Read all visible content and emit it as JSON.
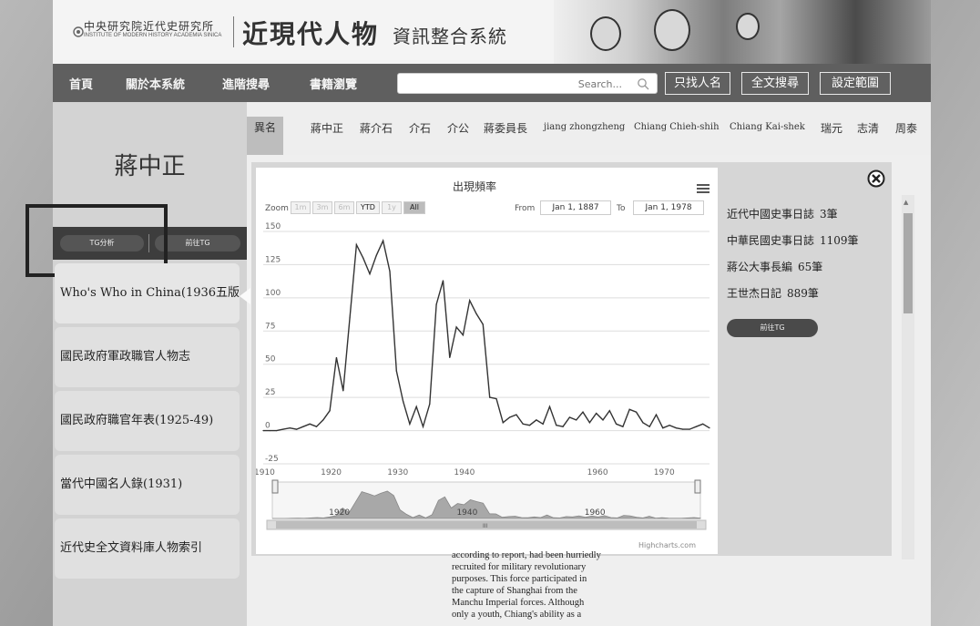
{
  "header": {
    "institute_name": "中央研究院近代史研究所",
    "institute_sub": "INSTITUTE OF MODERN HISTORY ACADEMIA SINICA",
    "site_title": "近現代人物",
    "site_subtitle": "資訊整合系統"
  },
  "nav": {
    "items": [
      "首頁",
      "關於本系統",
      "進階搜尋",
      "書籍瀏覽"
    ],
    "search_placeholder": "Search...",
    "buttons": [
      "只找人名",
      "全文搜尋",
      "設定範圍"
    ]
  },
  "sidebar": {
    "person_name": "蔣中正",
    "tg_buttons": [
      "TG分析",
      "前往TG"
    ],
    "sources": [
      "Who's Who in China(1936五版)",
      "國民政府軍政職官人物志",
      "國民政府職官年表(1925-49)",
      "當代中國名人錄(1931)",
      "近代史全文資料庫人物索引"
    ]
  },
  "aliases": {
    "tag": "異名",
    "names": [
      "蔣中正",
      "蔣介石",
      "介石",
      "介公",
      "蔣委員長",
      "jiang zhongzheng",
      "Chiang Chieh-shih",
      "Chiang Kai-shek",
      "瑞元",
      "志清",
      "周泰"
    ]
  },
  "panel": {
    "counts": [
      {
        "source": "近代中國史事日誌",
        "count": "3筆"
      },
      {
        "source": "中華民國史事日誌",
        "count": "1109筆"
      },
      {
        "source": "蔣公大事長編",
        "count": "65筆"
      },
      {
        "source": "王世杰日記",
        "count": "889筆"
      }
    ],
    "goto_label": "前往TG"
  },
  "chart_ui": {
    "zoom_label": "Zoom",
    "zoom_buttons": [
      "1m",
      "3m",
      "6m",
      "YTD",
      "1y",
      "All"
    ],
    "from_label": "From",
    "from_value": "Jan 1, 1887",
    "to_label": "To",
    "to_value": "Jan 1, 1978",
    "credit": "Highcharts.com",
    "nav_labels": [
      "1920",
      "1940",
      "1960"
    ],
    "scroll_label": "III"
  },
  "chart_data": {
    "type": "line",
    "title": "出現頻率",
    "xlabel": "",
    "ylabel": "",
    "x_ticks": [
      1910,
      1920,
      1930,
      1940,
      1960,
      1970
    ],
    "y_ticks": [
      -25,
      0,
      25,
      50,
      75,
      100,
      125,
      150
    ],
    "xlim": [
      1910,
      1977
    ],
    "ylim": [
      -25,
      150
    ],
    "grid": true,
    "x": [
      1910,
      1911,
      1912,
      1913,
      1914,
      1915,
      1916,
      1917,
      1918,
      1919,
      1920,
      1921,
      1922,
      1923,
      1924,
      1925,
      1926,
      1927,
      1928,
      1929,
      1930,
      1931,
      1932,
      1933,
      1934,
      1935,
      1936,
      1937,
      1938,
      1939,
      1940,
      1941,
      1942,
      1943,
      1944,
      1945,
      1946,
      1947,
      1948,
      1949,
      1950,
      1951,
      1952,
      1953,
      1954,
      1955,
      1956,
      1957,
      1958,
      1959,
      1960,
      1961,
      1962,
      1963,
      1964,
      1965,
      1966,
      1967,
      1968,
      1969,
      1970,
      1971,
      1972,
      1973,
      1974,
      1975,
      1976,
      1977
    ],
    "values": [
      0,
      0,
      0,
      1,
      2,
      1,
      3,
      5,
      3,
      8,
      15,
      55,
      30,
      85,
      140,
      130,
      118,
      132,
      143,
      120,
      45,
      22,
      5,
      18,
      3,
      20,
      95,
      113,
      55,
      78,
      72,
      98,
      88,
      80,
      25,
      24,
      6,
      10,
      12,
      5,
      4,
      8,
      5,
      18,
      4,
      3,
      10,
      8,
      14,
      6,
      13,
      8,
      15,
      5,
      3,
      16,
      14,
      6,
      3,
      12,
      2,
      4,
      2,
      1,
      1,
      3,
      5,
      2
    ]
  },
  "bio": {
    "text": "according to report, had been hurriedly\nrecruited for military revolutionary\npurposes. This force participated in\nthe capture of Shanghai from the\nManchu Imperial forces. Although\nonly a youth, Chiang's ability as a"
  }
}
